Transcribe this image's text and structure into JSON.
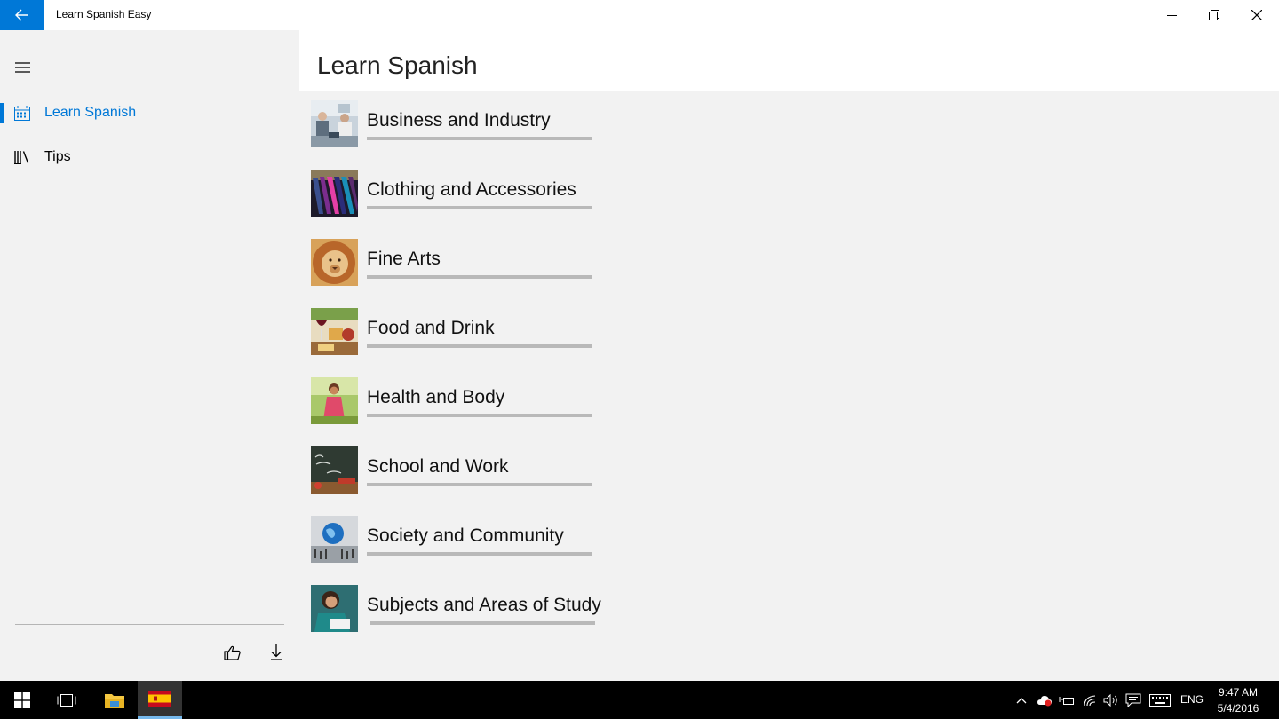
{
  "window": {
    "app_title": "Learn Spanish Easy",
    "accent_color": "#0078d7"
  },
  "sidebar": {
    "items": [
      {
        "label": "Learn Spanish",
        "icon": "calendar-icon",
        "active": true
      },
      {
        "label": "Tips",
        "icon": "books-icon",
        "active": false
      }
    ],
    "footer_icons": [
      "thumbs-up-icon",
      "download-icon"
    ]
  },
  "main": {
    "page_title": "Learn Spanish",
    "topics": [
      {
        "label": "Business and Industry",
        "thumbnail": "business-meeting-photo"
      },
      {
        "label": "Clothing and Accessories",
        "thumbnail": "clothing-rack-photo"
      },
      {
        "label": "Fine Arts",
        "thumbnail": "lion-painting-photo"
      },
      {
        "label": "Food and Drink",
        "thumbnail": "wine-and-cheese-photo"
      },
      {
        "label": "Health and Body",
        "thumbnail": "woman-in-park-photo"
      },
      {
        "label": "School and Work",
        "thumbnail": "chalkboard-back-to-school-photo"
      },
      {
        "label": "Society and Community",
        "thumbnail": "globe-people-photo"
      },
      {
        "label": "Subjects and Areas of Study",
        "thumbnail": "student-reading-photo"
      }
    ]
  },
  "taskbar": {
    "language": "ENG",
    "time": "9:47 AM",
    "date": "5/4/2016",
    "pinned": [
      "windows-start-icon",
      "task-view-icon",
      "file-explorer-icon",
      "spain-flag-app-icon"
    ],
    "tray": [
      "chevron-up-icon",
      "cloud-sync-icon",
      "battery-icon",
      "wifi-icon",
      "volume-icon",
      "action-center-icon",
      "keyboard-icon"
    ]
  }
}
